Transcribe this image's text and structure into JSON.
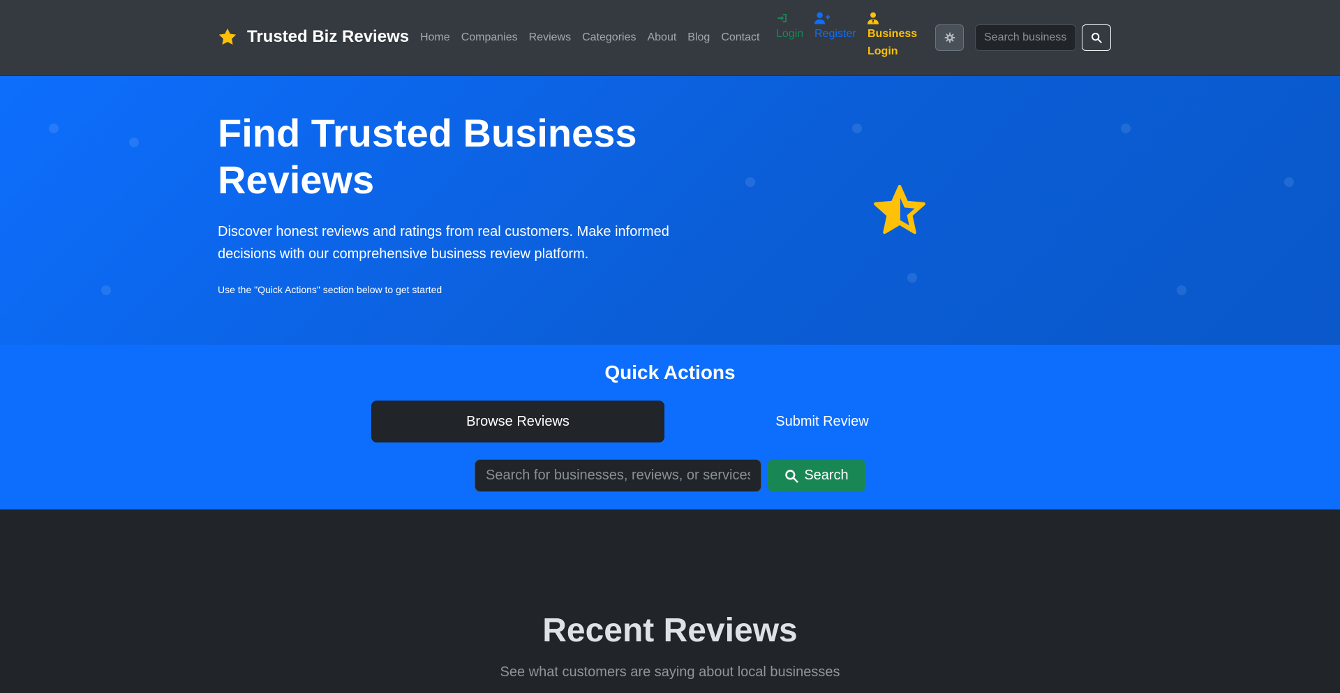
{
  "navbar": {
    "brand": "Trusted Biz Reviews",
    "brand_icon": "star-icon",
    "links": [
      "Home",
      "Companies",
      "Reviews",
      "Categories",
      "About",
      "Blog",
      "Contact"
    ],
    "login": {
      "label": "Login",
      "icon": "sign-in-icon",
      "color": "#198754"
    },
    "register": {
      "label": "Register",
      "icon": "user-plus-icon",
      "color": "#0d6efd"
    },
    "business_login": {
      "label": "Business Login",
      "icon": "user-tie-icon",
      "color": "#ffc107"
    },
    "theme_toggle_icon": "gear-icon",
    "search_placeholder": "Search businesses...",
    "search_icon": "search-icon"
  },
  "hero": {
    "title": "Find Trusted Business Reviews",
    "lead": "Discover honest reviews and ratings from real customers. Make informed decisions with our comprehensive business review platform.",
    "hint_icon": "",
    "hint": " Use the \"Quick Actions\" section below to get started",
    "illustration_icon": "star-half-icon",
    "background_color": "#0d6efd"
  },
  "quick_actions": {
    "title": "Quick Actions",
    "browse_label": " Browse Reviews",
    "submit_label": " Submit Review",
    "search_placeholder": "Search for businesses, reviews, or services...",
    "search_button": "Search"
  },
  "recent_reviews": {
    "title": "Recent Reviews",
    "subtitle": "See what customers are saying about local businesses"
  },
  "colors": {
    "navbar_bg": "#343a40",
    "accent": "#0d6efd",
    "success": "#198754",
    "warning": "#ffc107",
    "dark_bg": "#212529"
  }
}
